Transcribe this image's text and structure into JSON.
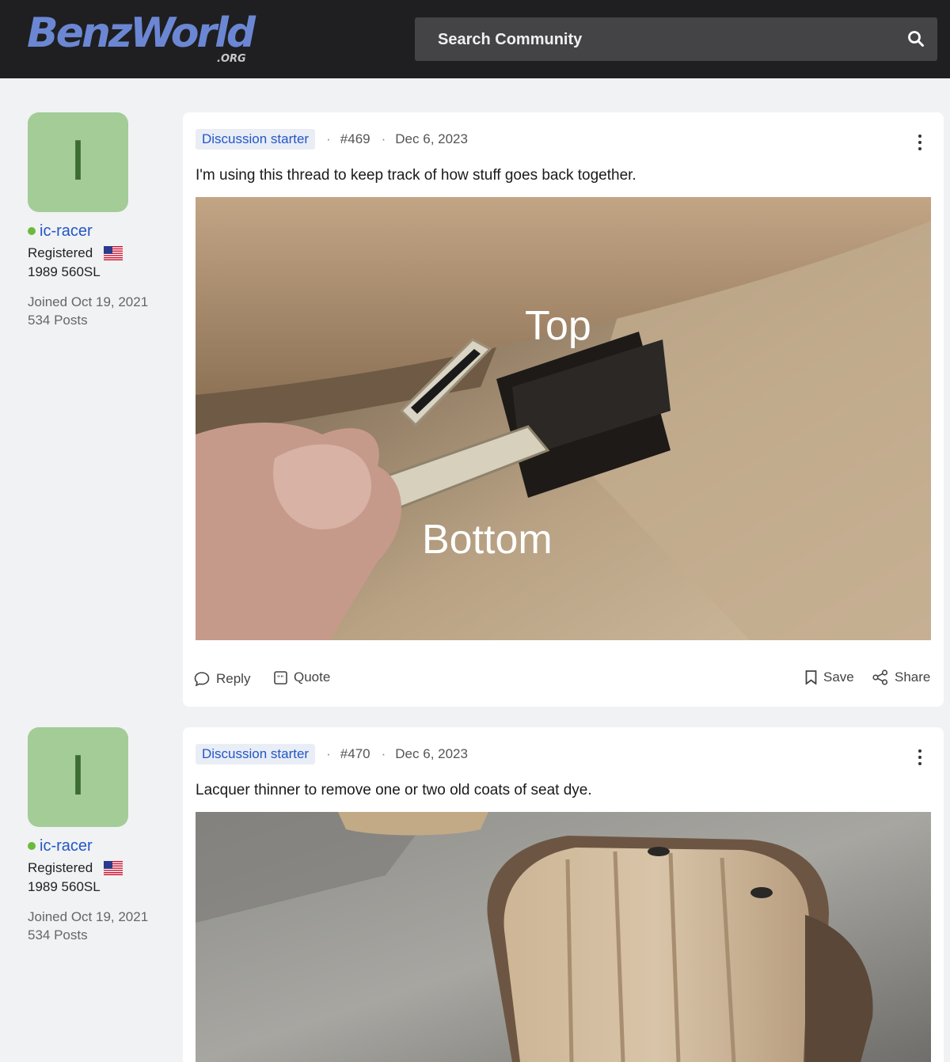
{
  "header": {
    "logo_main": "BenzWorld",
    "logo_sub": ".ORG",
    "search_placeholder": "Search Community"
  },
  "posts": [
    {
      "avatar_letter": "I",
      "username": "ic-racer",
      "role": "Registered",
      "car": "1989 560SL",
      "joined": "Joined Oct 19, 2021",
      "post_count": "534 Posts",
      "badge": "Discussion starter",
      "post_number": "#469",
      "date": "Dec 6, 2023",
      "text": "I'm using this thread to keep track of how stuff goes back together.",
      "image_labels": {
        "top": "Top",
        "bottom": "Bottom"
      },
      "actions": {
        "reply": "Reply",
        "quote": "Quote",
        "save": "Save",
        "share": "Share"
      }
    },
    {
      "avatar_letter": "I",
      "username": "ic-racer",
      "role": "Registered",
      "car": "1989 560SL",
      "joined": "Joined Oct 19, 2021",
      "post_count": "534 Posts",
      "badge": "Discussion starter",
      "post_number": "#470",
      "date": "Dec 6, 2023",
      "text": "Lacquer thinner to remove one or two old coats of seat dye."
    }
  ],
  "icons": [
    "search-icon",
    "flag-icon",
    "menu-icon",
    "reply-icon",
    "quote-icon",
    "save-icon",
    "share-icon"
  ],
  "colors": {
    "header_bg": "#1f1f21",
    "logo": "#6b87d4",
    "link": "#2356c7",
    "avatar_bg": "#a3cc97",
    "online": "#6bba3b"
  }
}
